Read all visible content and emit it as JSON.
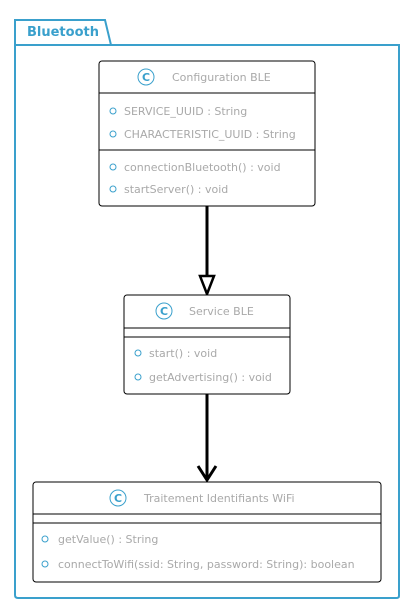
{
  "package": {
    "name": "Bluetooth"
  },
  "classes": {
    "config": {
      "icon": "C",
      "name": "Configuration BLE",
      "attributes": [
        "SERVICE_UUID : String",
        "CHARACTERISTIC_UUID : String"
      ],
      "methods": [
        "connectionBluetooth() : void",
        "startServer() : void"
      ]
    },
    "service": {
      "icon": "C",
      "name": "Service BLE",
      "attributes": [],
      "methods": [
        "start() : void",
        "getAdvertising() : void"
      ]
    },
    "wifi": {
      "icon": "C",
      "name": "Traitement Identifiants WiFi",
      "attributes": [],
      "methods": [
        "getValue() : String",
        "connectToWifi(ssid: String, password: String): boolean"
      ]
    }
  },
  "relations": [
    {
      "from": "config",
      "to": "service",
      "type": "inheritance"
    },
    {
      "from": "service",
      "to": "wifi",
      "type": "association"
    }
  ],
  "colors": {
    "accent": "#3aa0cc",
    "text": "#a9a9a9",
    "border": "#000000"
  }
}
